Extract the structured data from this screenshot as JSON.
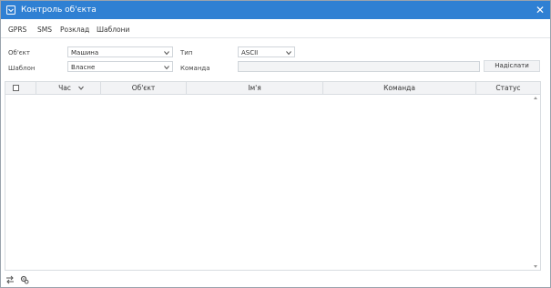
{
  "window": {
    "title": "Контроль об'єкта",
    "accent_color": "#2f80d3"
  },
  "tabs": [
    {
      "label": "GPRS"
    },
    {
      "label": "SMS"
    },
    {
      "label": "Розклад"
    },
    {
      "label": "Шаблони"
    }
  ],
  "form": {
    "object_label": "Об'єкт",
    "object_value": "Машина",
    "type_label": "Тип",
    "type_value": "ASCII",
    "template_label": "Шаблон",
    "template_value": "Власне",
    "command_label": "Команда",
    "command_value": "",
    "send_label": "Надіслати"
  },
  "grid": {
    "columns": [
      "",
      "Час",
      "Об'єкт",
      "Ім'я",
      "Команда",
      "Статус"
    ],
    "rows": []
  },
  "icons": {
    "window": "monitor-icon",
    "close": "close-icon",
    "sort": "chevron-down-icon",
    "footer": [
      "swap-arrows-icon",
      "gears-icon"
    ]
  }
}
